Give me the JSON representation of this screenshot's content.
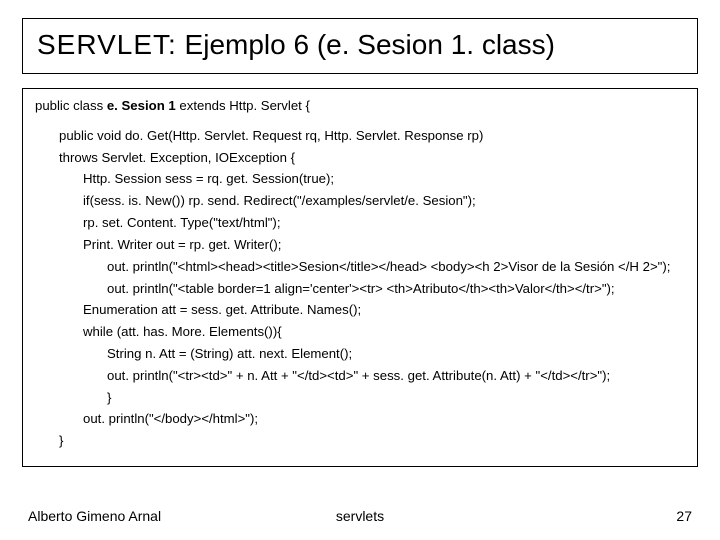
{
  "title": {
    "prefix": "SERVLET:",
    "rest": " Ejemplo 6 (e. Sesion 1. class)"
  },
  "code": {
    "l0": "public class e. Sesion 1 extends Http. Servlet {",
    "l1": "public void do. Get(Http. Servlet. Request rq, Http. Servlet. Response rp)",
    "l2": "throws Servlet. Exception, IOException {",
    "l3": "Http. Session sess = rq. get. Session(true);",
    "l4": "if(sess. is. New()) rp. send. Redirect(\"/examples/servlet/e. Sesion\");",
    "l5": "rp. set. Content. Type(\"text/html\");",
    "l6": "Print. Writer out = rp. get. Writer();",
    "l7": "out. println(\"<html><head><title>Sesion</title></head> <body><h 2>Visor de la Sesión </H 2>\");",
    "l8": "out. println(\"<table border=1 align='center'><tr> <th>Atributo</th><th>Valor</th></tr>\");",
    "l9": "Enumeration att = sess. get. Attribute. Names();",
    "l10": "while (att. has. More. Elements()){",
    "l11": "String n. Att = (String) att. next. Element();",
    "l12": "out. println(\"<tr><td>\" + n. Att + \"</td><td>\" + sess. get. Attribute(n. Att) + \"</td></tr>\");",
    "l13": "}",
    "l14": "out. println(\"</body></html>\");",
    "l15": "}"
  },
  "code_bold": {
    "decl_a": "public class ",
    "decl_b": "e. Sesion 1",
    "decl_c": " extends Http. Servlet {"
  },
  "footer": {
    "left": "Alberto Gimeno Arnal",
    "center": "servlets",
    "right": "27"
  }
}
